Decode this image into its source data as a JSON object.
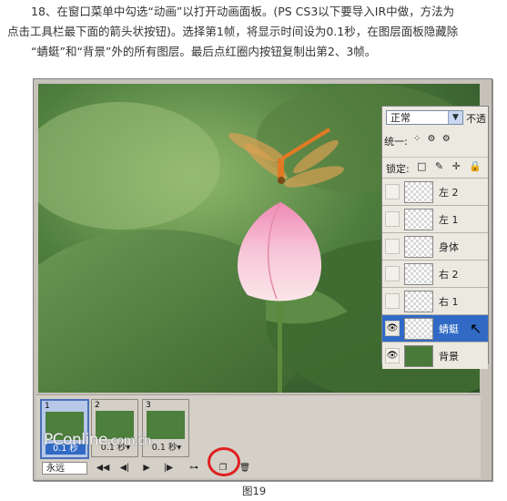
{
  "caption": {
    "line1": "18、在窗口菜单中勾选“动画”以打开动画面板。(PS CS3以下要导入IR中做，方法为",
    "line2": "点击工具栏最下面的箭头状按钮)。选择第1帧，将显示时间设为0.1秒，在图层面板隐藏除",
    "line3": "“蜻蜓”和“背景”外的所有图层。最后点红圈内按钮复制出第2、3帧。"
  },
  "layers_panel": {
    "blend_mode": "正常",
    "opacity_label": "不透",
    "unify_label": "统一:",
    "lock_label": "锁定:",
    "layers": [
      {
        "name": "左 2",
        "visible": false,
        "selected": false,
        "thumb": "transparent"
      },
      {
        "name": "左 1",
        "visible": false,
        "selected": false,
        "thumb": "transparent"
      },
      {
        "name": "身体",
        "visible": false,
        "selected": false,
        "thumb": "transparent"
      },
      {
        "name": "右 2",
        "visible": false,
        "selected": false,
        "thumb": "transparent"
      },
      {
        "name": "右 1",
        "visible": false,
        "selected": false,
        "thumb": "transparent"
      },
      {
        "name": "蜻蜓",
        "visible": true,
        "selected": true,
        "thumb": "transparent"
      },
      {
        "name": "背景",
        "visible": true,
        "selected": false,
        "thumb": "photo"
      }
    ]
  },
  "animation_panel": {
    "frames": [
      {
        "number": "1",
        "delay": "0.1 秒",
        "active": true
      },
      {
        "number": "2",
        "delay": "0.1 秒▾",
        "active": false
      },
      {
        "number": "3",
        "delay": "0.1 秒▾",
        "active": false
      }
    ],
    "loop": "永远",
    "toolbar": [
      "◀◀",
      "◀|",
      "▶",
      "|▶",
      "⊶",
      "❐",
      "🗑"
    ]
  },
  "watermark": {
    "main": "PConline",
    "suffix": ".com.cn"
  },
  "figure_label": "图19",
  "colors": {
    "selection": "#316ac5",
    "highlight_circle": "#e02020"
  }
}
